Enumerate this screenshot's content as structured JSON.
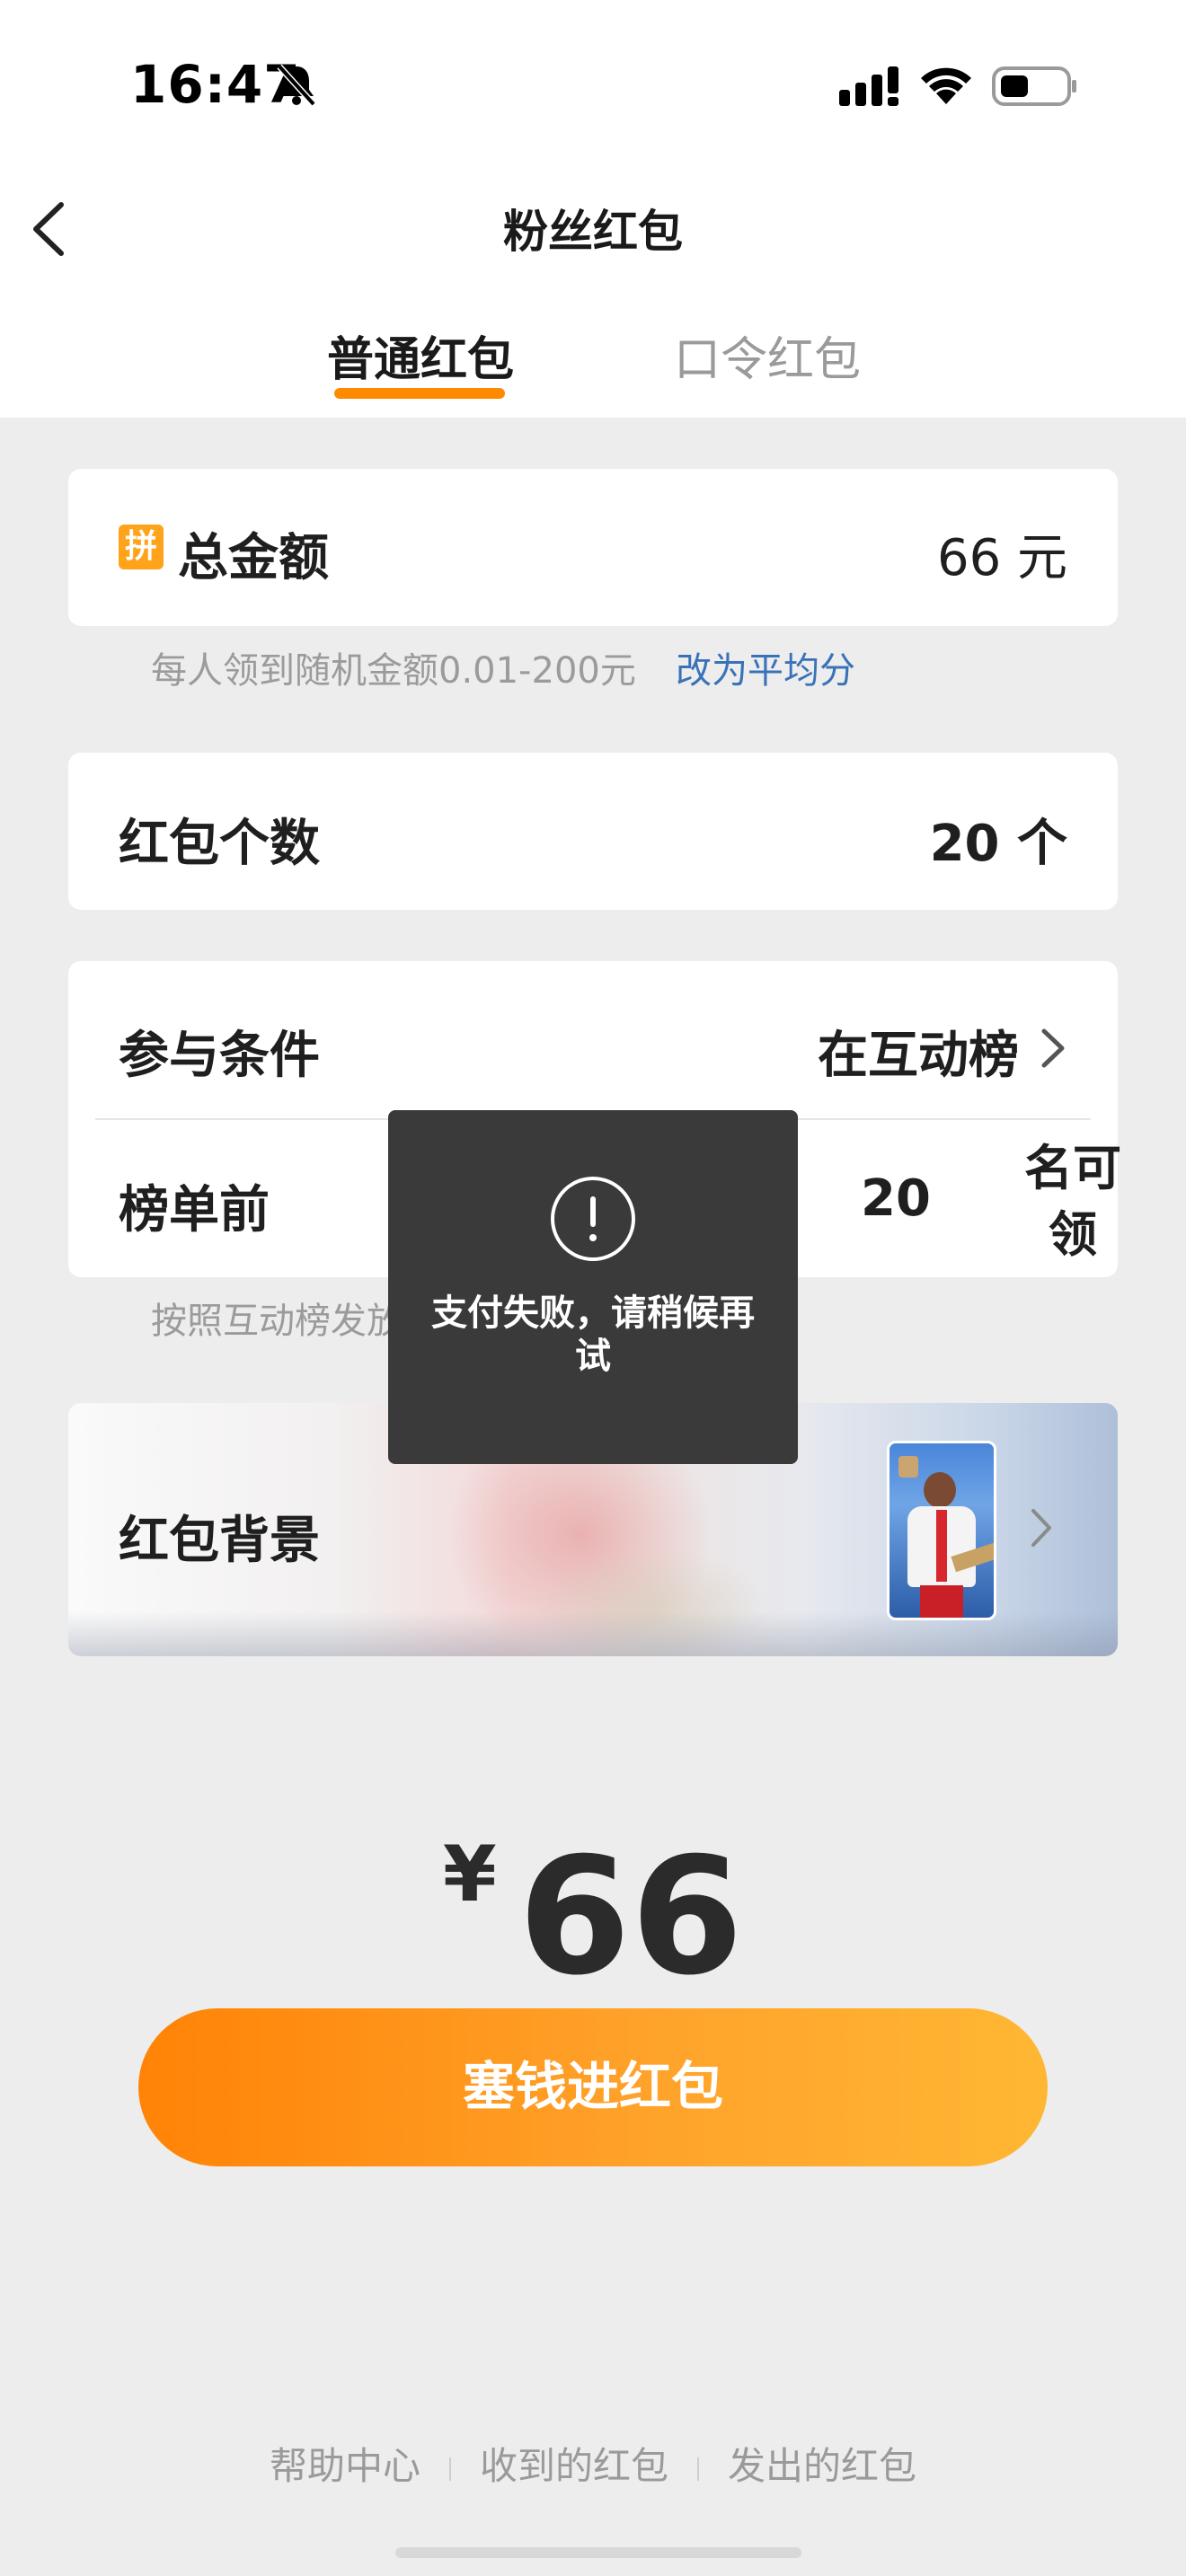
{
  "status_bar": {
    "time": "16:47",
    "icons": [
      "bell-slash-icon",
      "cellular-signal-icon",
      "wifi-icon",
      "battery-icon"
    ]
  },
  "header": {
    "title": "粉丝红包",
    "back_icon": "chevron-left-icon"
  },
  "tabs": [
    {
      "label": "普通红包",
      "active": true
    },
    {
      "label": "口令红包",
      "active": false
    }
  ],
  "form": {
    "amount": {
      "badge": "拼",
      "label": "总金额",
      "value": "66 元"
    },
    "amount_hint": "每人领到随机金额0.01-200元",
    "amount_hint_link": "改为平均分",
    "count": {
      "label": "红包个数",
      "value": "20 个"
    },
    "condition": {
      "label": "参与条件",
      "value": "在互动榜"
    },
    "rank": {
      "label": "榜单前",
      "value": "20",
      "suffix": "名可领"
    },
    "rank_hint": "按照互动榜发放",
    "background": {
      "label": "红包背景"
    }
  },
  "toast": {
    "icon": "exclamation-circle-icon",
    "message": "支付失败，请稍候再试"
  },
  "price": {
    "symbol": "¥",
    "amount": "66"
  },
  "pay_button": "塞钱进红包",
  "footer": {
    "links": [
      "帮助中心",
      "收到的红包",
      "发出的红包"
    ]
  },
  "colors": {
    "accent": "#ff8a00",
    "link": "#3a72b8",
    "toast_bg": "#3a3a3a",
    "page_bg": "#ededed"
  }
}
